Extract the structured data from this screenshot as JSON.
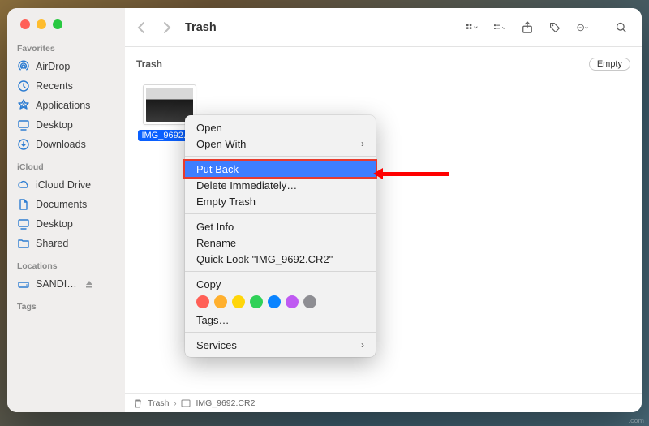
{
  "window": {
    "title": "Trash"
  },
  "sidebar": {
    "sections": [
      {
        "label": "Favorites",
        "items": [
          {
            "icon": "airdrop",
            "label": "AirDrop"
          },
          {
            "icon": "clock",
            "label": "Recents"
          },
          {
            "icon": "apps",
            "label": "Applications"
          },
          {
            "icon": "desktop",
            "label": "Desktop"
          },
          {
            "icon": "downloads",
            "label": "Downloads"
          }
        ]
      },
      {
        "label": "iCloud",
        "items": [
          {
            "icon": "cloud",
            "label": "iCloud Drive"
          },
          {
            "icon": "doc",
            "label": "Documents"
          },
          {
            "icon": "desktop",
            "label": "Desktop"
          },
          {
            "icon": "folder",
            "label": "Shared"
          }
        ]
      },
      {
        "label": "Locations",
        "items": [
          {
            "icon": "drive",
            "label": "SANDI…",
            "eject": true
          }
        ]
      },
      {
        "label": "Tags",
        "items": []
      }
    ]
  },
  "subheader": {
    "title": "Trash",
    "empty_btn": "Empty"
  },
  "file": {
    "name": "IMG_9692.CR2",
    "short": "IMG_9692.CF"
  },
  "context_menu": {
    "items": [
      {
        "label": "Open"
      },
      {
        "label": "Open With",
        "submenu": true
      },
      {
        "sep": true
      },
      {
        "label": "Put Back",
        "highlight": true
      },
      {
        "label": "Delete Immediately…"
      },
      {
        "label": "Empty Trash"
      },
      {
        "sep": true
      },
      {
        "label": "Get Info"
      },
      {
        "label": "Rename"
      },
      {
        "label": "Quick Look \"IMG_9692.CR2\""
      },
      {
        "sep": true
      },
      {
        "label": "Copy"
      },
      {
        "tags": true,
        "colors": [
          "#ff5f56",
          "#ffb02e",
          "#ffd60a",
          "#30d158",
          "#0a84ff",
          "#bf5af2",
          "#8e8e93"
        ]
      },
      {
        "label": "Tags…"
      },
      {
        "sep": true
      },
      {
        "label": "Services",
        "submenu": true
      }
    ]
  },
  "pathbar": {
    "trash": "Trash",
    "file": "IMG_9692.CR2"
  }
}
